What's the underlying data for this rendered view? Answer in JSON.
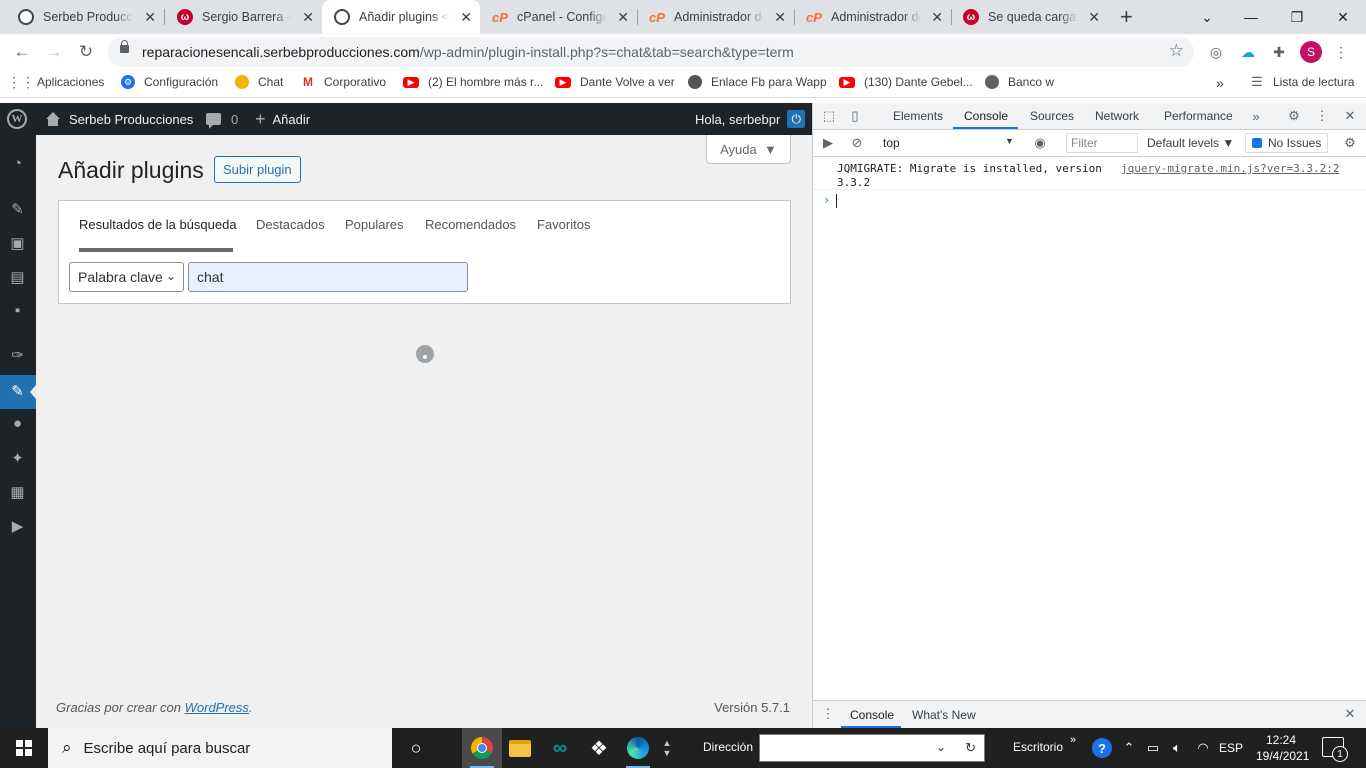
{
  "browser": {
    "tabs": [
      {
        "title": "Serbeb Produccio",
        "icon": "wordpress-icon"
      },
      {
        "title": "Sergio Barrera – A",
        "icon": "red-w-icon"
      },
      {
        "title": "Añadir plugins <",
        "icon": "wordpress-icon"
      },
      {
        "title": "cPanel - Configur",
        "icon": "cpanel-icon"
      },
      {
        "title": "Administrador de",
        "icon": "cpanel-icon"
      },
      {
        "title": "Administrador de",
        "icon": "cpanel-icon"
      },
      {
        "title": "Se queda cargand",
        "icon": "red-w-icon"
      }
    ],
    "url_domain": "reparacionesencali.serbebproducciones.com",
    "url_path": "/wp-admin/plugin-install.php?s=chat&tab=search&type=term",
    "profile_initial": "S",
    "bookmarks": [
      {
        "label": "Aplicaciones",
        "icon": "apps-icon"
      },
      {
        "label": "Configuración",
        "icon": "gear-icon"
      },
      {
        "label": "Chat",
        "icon": "chat-icon"
      },
      {
        "label": "Corporativo",
        "icon": "gmail-icon"
      },
      {
        "label": "(2) El hombre más r...",
        "icon": "youtube-icon"
      },
      {
        "label": "Dante Volve a ver",
        "icon": "youtube-icon"
      },
      {
        "label": "Enlace Fb para Wapp",
        "icon": "fb-icon"
      },
      {
        "label": "(130) Dante Gebel...",
        "icon": "youtube-icon"
      },
      {
        "label": "Banco w",
        "icon": "globe-icon"
      }
    ],
    "overflow_label": "»",
    "reading_list": "Lista de lectura"
  },
  "wp_adminbar": {
    "site_name": "Serbeb Producciones",
    "comments_count": "0",
    "add_label": "Añadir",
    "greeting": "Hola, serbebpr"
  },
  "wp_page": {
    "help_label": "Ayuda",
    "title": "Añadir plugins",
    "upload_label": "Subir plugin",
    "filter_tabs": [
      "Resultados de la búsqueda",
      "Destacados",
      "Populares",
      "Recomendados",
      "Favoritos"
    ],
    "search_type": "Palabra clave",
    "search_value": "chat",
    "footer_text": "Gracias por crear con ",
    "footer_link": "WordPress",
    "footer_end": ".",
    "version": "Versión 5.7.1"
  },
  "devtools": {
    "tabs": [
      "Elements",
      "Console",
      "Sources",
      "Network",
      "Performance"
    ],
    "context": "top",
    "filter_placeholder": "Filter",
    "levels": "Default levels ▼",
    "issues": "No Issues",
    "message_line1": "JQMIGRATE: Migrate is installed, version",
    "message_line2": "3.3.2",
    "message_source": "jquery-migrate.min.js?ver=3.3.2:2",
    "drawer_tabs": [
      "Console",
      "What's New"
    ]
  },
  "taskbar": {
    "search_placeholder": "Escribe aquí para buscar",
    "address_label": "Dirección",
    "desktop_label": "Escritorio",
    "language": "ESP",
    "time": "12:24",
    "date": "19/4/2021",
    "notification_count": "1"
  }
}
